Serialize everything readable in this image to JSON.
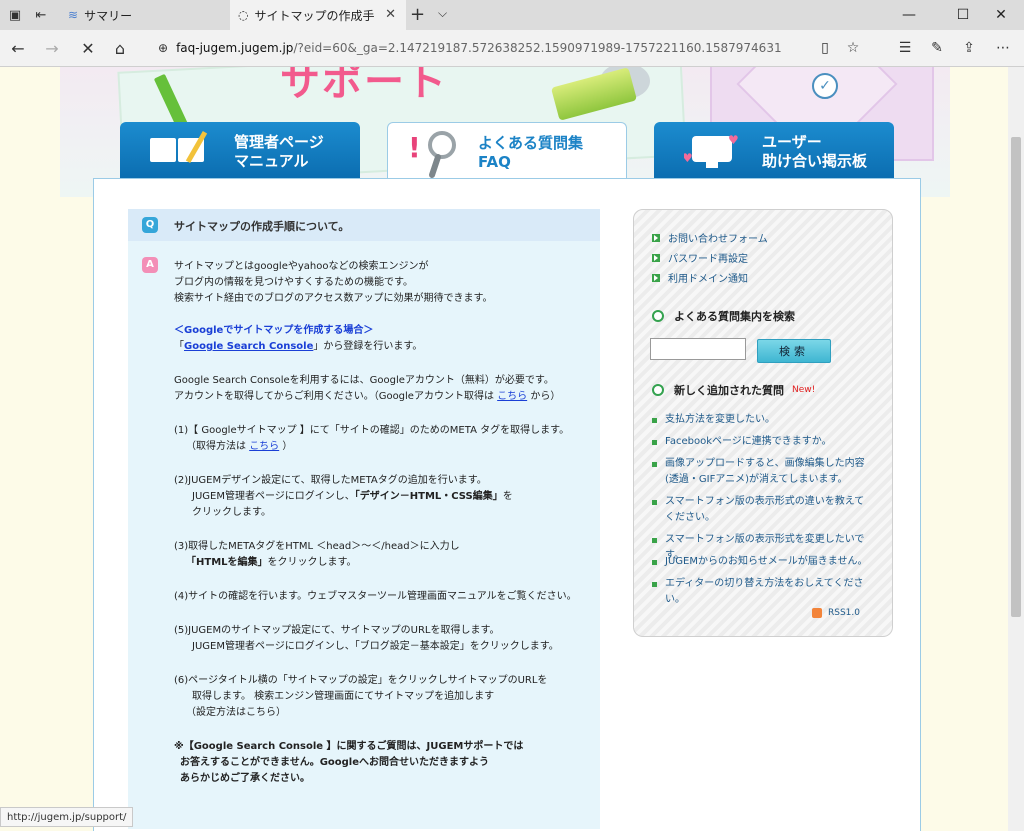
{
  "browser": {
    "tabs": [
      {
        "label": "サマリー",
        "active": false
      },
      {
        "label": "サイトマップの作成手順につ",
        "active": true
      }
    ],
    "address": {
      "host": "faq-jugem.jugem.jp",
      "rest": "/?eid=60&_ga=2.147219187.572638252.1590971989-1757221160.1587974631"
    },
    "status_url": "http://jugem.jp/support/"
  },
  "hero": {
    "title_text": "サポート"
  },
  "nav_tabs": [
    {
      "line1": "管理者ページ",
      "line2": "マニュアル"
    },
    {
      "line1": "よくある質問集",
      "line2": "FAQ"
    },
    {
      "line1": "ユーザー",
      "line2": "助け合い掲示板"
    }
  ],
  "faq": {
    "q_badge": "Q",
    "a_badge": "A",
    "question": "サイトマップの作成手順について。",
    "intro": [
      "サイトマップとはgoogleやyahooなどの検索エンジンが",
      "ブログ内の情報を見つけやすくするための機能です。",
      "検索サイト経由でのブログのアクセス数アップに効果が期待できます。"
    ],
    "google_heading": "＜Googleでサイトマップを作成する場合＞",
    "gsc_open": "「",
    "gsc_link": "Google Search Console",
    "gsc_close": "」から登録を行います。",
    "account_line1": "Google Search Consoleを利用するには、Googleアカウント（無料）が必要です。",
    "account_line2_pre": "アカウントを取得してからご利用ください。（Googleアカウント取得は ",
    "account_link": "こちら",
    "account_line2_post": " から）",
    "step1_line1": "(1)【 Googleサイトマップ 】にて「サイトの確認」のためのMETA タグを取得します。",
    "step1_line2_pre": "（取得方法は ",
    "step1_link": "こちら",
    "step1_line2_post": " ）",
    "step2_line1": "(2)JUGEMデザイン設定にて、取得したMETAタグの追加を行います。",
    "step2_line2_pre": "JUGEM管理者ページにログインし、",
    "step2_line2_bold": "「デザイン－HTML・CSS編集」",
    "step2_line2_post": "を",
    "step2_line3": "クリックします。",
    "step3_line1": "(3)取得したMETAタグをHTML ＜head＞～＜/head＞に入力し",
    "step3_line2_bold": "「HTMLを編集」",
    "step3_line2_post": "をクリックします。",
    "step4": "(4)サイトの確認を行います。ウェブマスターツール管理画面マニュアルをご覧ください。",
    "step5_line1": "(5)JUGEMのサイトマップ設定にて、サイトマップのURLを取得します。",
    "step5_line2": "JUGEM管理者ページにログインし、「ブログ設定－基本設定」をクリックします。",
    "step6_line1": "(6)ページタイトル横の「サイトマップの設定」をクリックしサイトマップのURLを",
    "step6_line2": "取得します。 検索エンジン管理画面にてサイトマップを追加します",
    "step6_line3": "（設定方法はこちら）",
    "note_line1": "※【Google Search Console 】に関するご質問は、JUGEMサポートでは",
    "note_line2": "お答えすることができません。Googleへお問合せいただきますよう",
    "note_line3": "あらかじめご了承ください。"
  },
  "sidebar": {
    "links": [
      "お問い合わせフォーム",
      "パスワード再設定",
      "利用ドメイン通知"
    ],
    "search_heading": "よくある質問集内を検索",
    "search_button": "検索",
    "new_heading": "新しく追加された質問",
    "new_tag": "New!",
    "new_items": [
      "支払方法を変更したい。",
      "Facebookページに連携できますか。",
      "画像アップロードすると、画像編集した内容(透過・GIFアニメ)が消えてしまいます。",
      "スマートフォン版の表示形式の違いを教えてください。",
      "スマートフォン版の表示形式を変更したいです。",
      "JUGEMからのお知らせメールが届きません。",
      "エディターの切り替え方法をおしえてください。"
    ],
    "rss": "RSS1.0"
  },
  "colors": {
    "accent_blue": "#1c8ccf",
    "link": "#1a3fd6",
    "new_red": "#e02020",
    "green": "#3aa349"
  }
}
